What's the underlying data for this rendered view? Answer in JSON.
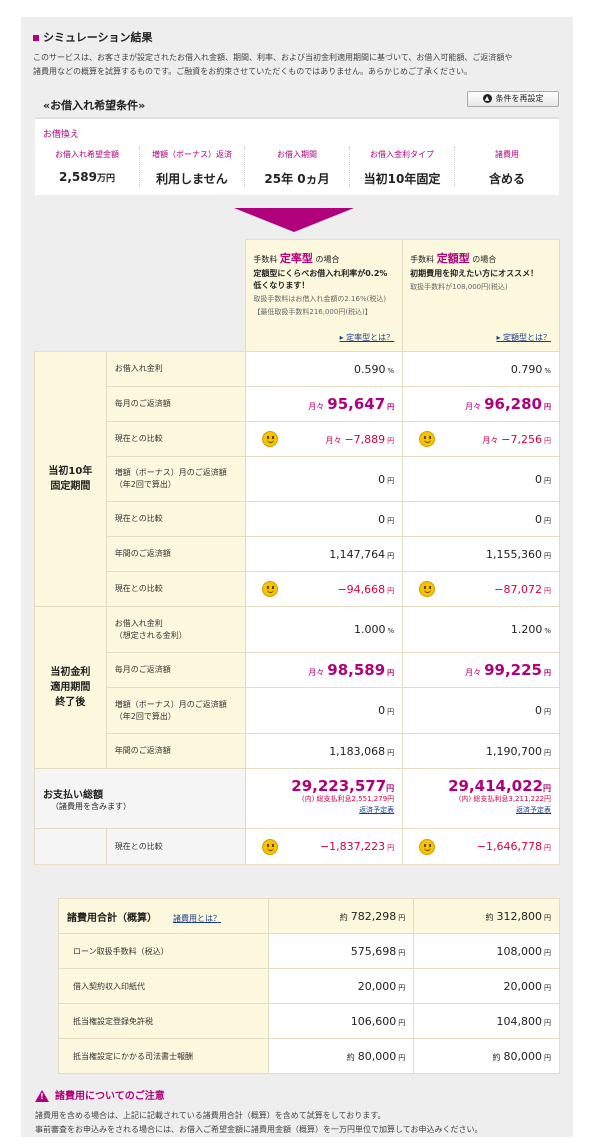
{
  "page": {
    "title": "シミュレーション結果",
    "intro_1": "このサービスは、お客さまが設定されたお借入れ金額、期間、利率、および当初金利適用期間に基づいて、お借入可能額、ご返済額や",
    "intro_2": "諸費用などの概算を試算するものです。ご融資をお約束させていただくものではありません。あらかじめご了承ください。"
  },
  "conditions": {
    "heading": "«お借入れ希望条件»",
    "reset_button": "条件を再設定",
    "type": "お借換え",
    "items": [
      {
        "label": "お借入れ希望金額",
        "value": "2,589",
        "unit": "万円"
      },
      {
        "label": "増額（ボーナス）返済",
        "value": "利用しません",
        "unit": ""
      },
      {
        "label": "お借入期間",
        "value": "25年 0ヵ月",
        "unit": ""
      },
      {
        "label": "お借入金利タイプ",
        "value": "当初10年固定",
        "unit": ""
      },
      {
        "label": "諸費用",
        "value": "含める",
        "unit": ""
      }
    ]
  },
  "plans": [
    {
      "prefix": "手数料",
      "name": "定率型",
      "suffix": "の場合",
      "desc": "定額型にくらべお借入れ利率が0.2%低くなります！",
      "fee_note_1": "取扱手数料はお借入れ金額の2.16%(税込)",
      "fee_note_2": "【最低取扱手数料216,000円(税込)】",
      "link": "定率型とは？"
    },
    {
      "prefix": "手数料",
      "name": "定額型",
      "suffix": "の場合",
      "desc": "初期費用を抑えたい方にオススメ！",
      "fee_note_1": "取扱手数料が108,000円(税込)",
      "fee_note_2": "",
      "link": "定額型とは？"
    }
  ],
  "section1": {
    "label": "当初10年\n固定期間",
    "rows": [
      {
        "label": "お借入れ金利",
        "v1": "0.590",
        "v2": "0.790",
        "unit": "%"
      },
      {
        "label": "毎月のご返済額",
        "v1": "95,647",
        "v2": "96,280",
        "pre": "月々",
        "unit": "円"
      },
      {
        "label": "現在との比較",
        "v1": "−7,889",
        "v2": "−7,256",
        "pre": "月々",
        "unit": "円"
      },
      {
        "label": "増額（ボーナス）月のご返済額\n（年2回で算出）",
        "v1": "0",
        "v2": "0",
        "unit": "円"
      },
      {
        "label": "現在との比較",
        "v1": "0",
        "v2": "0",
        "unit": "円"
      },
      {
        "label": "年間のご返済額",
        "v1": "1,147,764",
        "v2": "1,155,360",
        "unit": "円"
      },
      {
        "label": "現在との比較",
        "v1": "−94,668",
        "v2": "−87,072",
        "unit": "円"
      }
    ]
  },
  "section2": {
    "label": "当初金利\n適用期間\n終了後",
    "rows": [
      {
        "label": "お借入れ金利\n（想定される金利）",
        "v1": "1.000",
        "v2": "1.200",
        "unit": "%"
      },
      {
        "label": "毎月のご返済額",
        "v1": "98,589",
        "v2": "99,225",
        "pre": "月々",
        "unit": "円"
      },
      {
        "label": "増額（ボーナス）月のご返済額\n（年2回で算出）",
        "v1": "0",
        "v2": "0",
        "unit": "円"
      },
      {
        "label": "年間のご返済額",
        "v1": "1,183,068",
        "v2": "1,190,700",
        "unit": "円"
      }
    ]
  },
  "total": {
    "label": "お支払い総額",
    "sub": "（諸費用を含みます）",
    "v1": "29,223,577",
    "v2": "29,414,022",
    "unit": "円",
    "i1": "(内) 総支払利息2,551,279円",
    "i2": "(内) 総支払利息3,211,222円",
    "link": "返済予定表",
    "cmp_label": "現在との比較",
    "c1": "−1,837,223",
    "c2": "−1,646,778"
  },
  "fees": {
    "label": "諸費用合計（概算）",
    "link": "諸費用とは？",
    "total1": "782,298",
    "total2": "312,800",
    "approx": "約",
    "unit": "円",
    "rows": [
      {
        "label": "ローン取扱手数料（税込）",
        "v1": "575,698",
        "v2": "108,000",
        "pre": ""
      },
      {
        "label": "借入契約収入印紙代",
        "v1": "20,000",
        "v2": "20,000",
        "pre": ""
      },
      {
        "label": "抵当権設定登録免許税",
        "v1": "106,600",
        "v2": "104,800",
        "pre": ""
      },
      {
        "label": "抵当権設定にかかる司法書士報酬",
        "v1": "80,000",
        "v2": "80,000",
        "pre": "約"
      }
    ]
  },
  "notice": {
    "title": "諸費用についてのご注意",
    "line1": "諸費用を含める場合は、上記に記載されている諸費用合計（概算）を含めて試算をしております。",
    "line2": "事前審査をお申込みをされる場合には、お借入ご希望金額に諸費用金額（概算）を一万円単位で加算してお申込みください。"
  }
}
